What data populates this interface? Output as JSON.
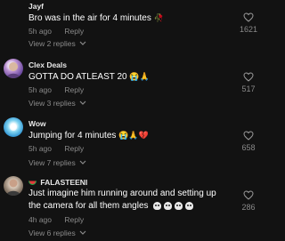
{
  "comments": [
    {
      "username": "Jayf",
      "text": "Bro was in the air for 4 minutes",
      "emoji": "🥀",
      "time": "5h ago",
      "reply_label": "Reply",
      "likes": "1621",
      "view_replies": "View 2 replies"
    },
    {
      "username": "Clex Deals",
      "text": "GOTTA DO ATLEAST 20",
      "emoji": "😭🙏",
      "time": "5h ago",
      "reply_label": "Reply",
      "likes": "517",
      "view_replies": "View 3 replies"
    },
    {
      "username": "Wow",
      "text": "Jumping for 4 minutes",
      "emoji": "😭🙏💔",
      "time": "5h ago",
      "reply_label": "Reply",
      "likes": "658",
      "view_replies": "View 7 replies"
    },
    {
      "username": "FALASTEENI",
      "text_line1": "Just imagine him running around and setting up",
      "text_line2": "the camera for all them angles",
      "time": "4h ago",
      "reply_label": "Reply",
      "likes": "286",
      "view_replies": "View 6 replies"
    }
  ],
  "colors": {
    "background": "#121212",
    "muted": "#8a8a8a",
    "text": "#ffffff"
  }
}
